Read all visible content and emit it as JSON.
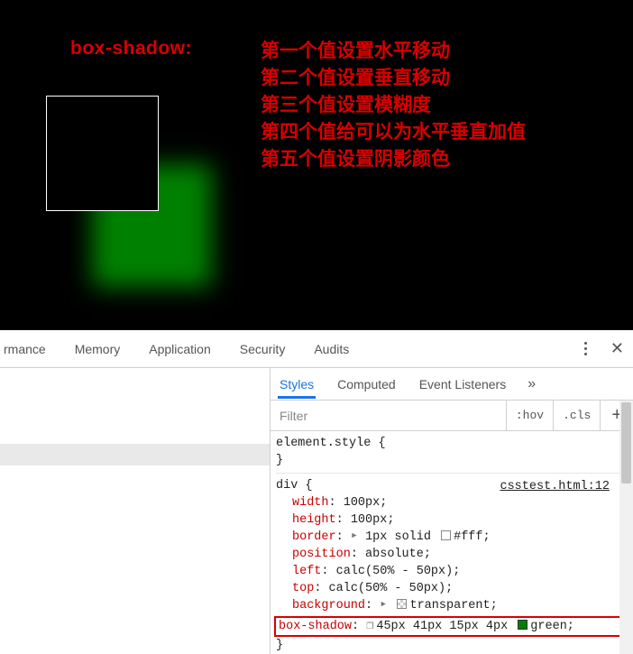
{
  "demo": {
    "title": "box-shadow:",
    "notes": [
      "第一个值设置水平移动",
      "第二个值设置垂直移动",
      "第三个值设置模糊度",
      "第四个值给可以为水平垂直加值",
      "第五个值设置阴影颜色"
    ]
  },
  "devtools": {
    "top_tabs": [
      "rmance",
      "Memory",
      "Application",
      "Security",
      "Audits"
    ],
    "side_tabs": [
      "Styles",
      "Computed",
      "Event Listeners"
    ],
    "active_side_tab": "Styles",
    "filter_placeholder": "Filter",
    "toggles": {
      "hov": ":hov",
      "cls": ".cls",
      "plus": "+"
    },
    "source_link": "csstest.html:12",
    "rules": {
      "element_style": {
        "selector": "element.style",
        "open": "{",
        "close": "}"
      },
      "div_rule": {
        "selector": "div",
        "open": "{",
        "close": "}",
        "decls": {
          "width": {
            "prop": "width",
            "val": "100px;"
          },
          "height": {
            "prop": "height",
            "val": "100px;"
          },
          "border": {
            "prop": "border",
            "val_pre": "1px solid ",
            "swatch": "white",
            "val_post": "#fff;"
          },
          "position": {
            "prop": "position",
            "val": "absolute;"
          },
          "left": {
            "prop": "left",
            "val": "calc(50% - 50px);"
          },
          "top": {
            "prop": "top",
            "val": "calc(50% - 50px);"
          },
          "background": {
            "prop": "background",
            "swatch": "transparent",
            "val_post": "transparent;"
          },
          "box_shadow": {
            "prop": "box-shadow",
            "val_pre": "45px 41px 15px 4px ",
            "swatch": "green",
            "val_post": "green;"
          }
        }
      }
    }
  }
}
